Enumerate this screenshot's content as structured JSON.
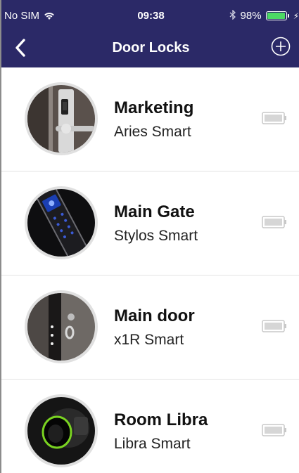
{
  "status_bar": {
    "carrier": "No SIM",
    "time": "09:38",
    "battery_percent": "98%",
    "battery_level": 0.98,
    "battery_color": "#4cd964"
  },
  "nav": {
    "title": "Door Locks",
    "back_icon": "chevron-left-icon",
    "add_icon": "plus-circle-icon",
    "background_color": "#2b2967"
  },
  "locks": [
    {
      "name": "Marketing",
      "model": "Aries Smart",
      "image": "door-handle-lock",
      "battery_icon": "battery-icon"
    },
    {
      "name": "Main Gate",
      "model": "Stylos Smart",
      "image": "keypad-lock",
      "battery_icon": "battery-icon"
    },
    {
      "name": "Main door",
      "model": "x1R Smart",
      "image": "deadbolt-lock",
      "battery_icon": "battery-icon"
    },
    {
      "name": "Room Libra",
      "model": "Libra Smart",
      "image": "cylinder-lock",
      "battery_icon": "battery-icon"
    }
  ]
}
